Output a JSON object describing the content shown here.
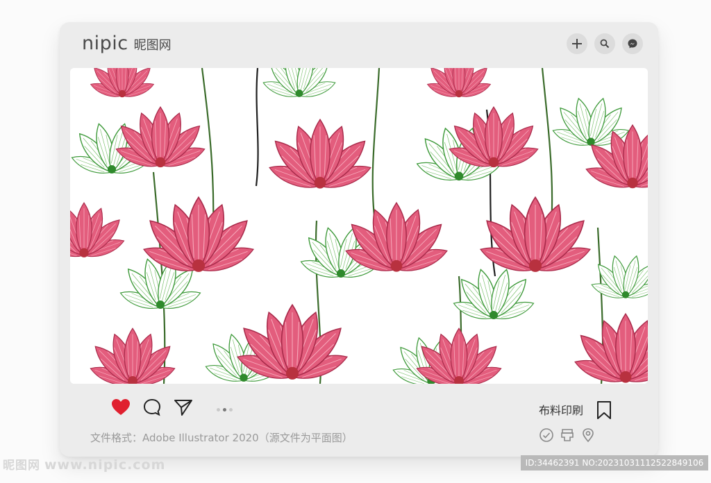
{
  "brand": {
    "name": "nipic",
    "name_cn": "昵图网"
  },
  "top_actions": [
    "plus-icon",
    "search-icon",
    "messenger-icon"
  ],
  "actions": {
    "like": "heart-icon",
    "comment": "comment-icon",
    "share": "send-icon",
    "liked_color": "#e0202f"
  },
  "carousel": {
    "dots": 3,
    "active_index": 1
  },
  "print_label": "布料印刷",
  "format_line": "文件格式：Adobe Illustrator 2020（源文件为平面图）",
  "meta_icons": [
    "check-circle-icon",
    "printer-icon",
    "location-pin-icon"
  ],
  "watermark": {
    "brand_cn": "昵图网",
    "url": "www.nipic.com"
  },
  "id_line": "ID:34462391 NO:20231031112522849106",
  "colors": {
    "lotus_pink": "#e05a7a",
    "leaf_green": "#3e9a3a",
    "card": "#ececec"
  }
}
